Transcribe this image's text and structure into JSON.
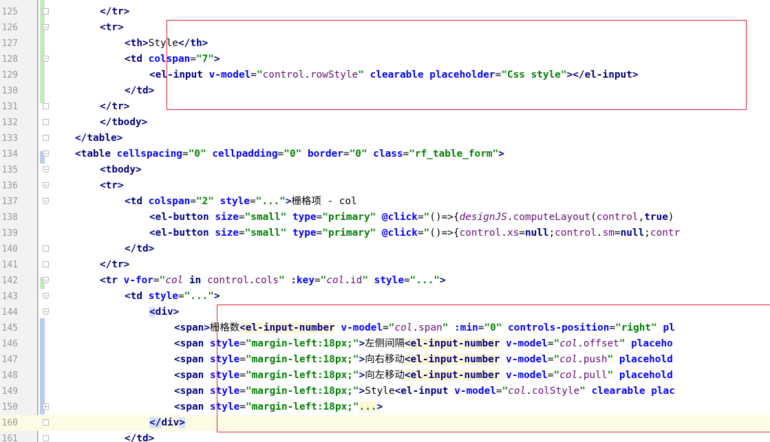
{
  "lines": [
    {
      "num": "125",
      "fold": "+",
      "current": false,
      "segments": [
        [
          "tg",
          "</tr>"
        ]
      ],
      "indent": 8
    },
    {
      "num": "126",
      "fold": "-",
      "current": false,
      "segments": [
        [
          "tg",
          "<tr>"
        ]
      ],
      "indent": 8
    },
    {
      "num": "127",
      "fold": "",
      "current": false,
      "segments": [
        [
          "tg",
          "<th>"
        ],
        [
          "tx",
          "Style"
        ],
        [
          "tg",
          "</th>"
        ]
      ],
      "indent": 12
    },
    {
      "num": "128",
      "fold": "-",
      "current": false,
      "segments": [
        [
          "tg",
          "<td "
        ],
        [
          "an",
          "colspan"
        ],
        [
          "js",
          "="
        ],
        [
          "av",
          "\"7\""
        ],
        [
          "tg",
          ">"
        ]
      ],
      "indent": 12
    },
    {
      "num": "129",
      "fold": "",
      "current": false,
      "segments": [
        [
          "tg",
          "<el-input "
        ],
        [
          "an",
          "v-model"
        ],
        [
          "js",
          "="
        ],
        [
          "av",
          "\""
        ],
        [
          "jsprop",
          "control"
        ],
        [
          "js",
          "."
        ],
        [
          "jsprop",
          "rowStyle"
        ],
        [
          "av",
          "\""
        ],
        [
          "js",
          " "
        ],
        [
          "an",
          "clearable"
        ],
        [
          "js",
          " "
        ],
        [
          "an",
          "placeholder"
        ],
        [
          "js",
          "="
        ],
        [
          "av",
          "\"Css style\""
        ],
        [
          "tg",
          "></el-input>"
        ]
      ],
      "indent": 16
    },
    {
      "num": "130",
      "fold": "",
      "current": false,
      "segments": [
        [
          "tg",
          "</td>"
        ]
      ],
      "indent": 12
    },
    {
      "num": "131",
      "fold": "+",
      "current": false,
      "segments": [
        [
          "tg",
          "</tr>"
        ]
      ],
      "indent": 8
    },
    {
      "num": "132",
      "fold": "+",
      "current": false,
      "segments": [
        [
          "tg",
          "</tbody>"
        ]
      ],
      "indent": 8
    },
    {
      "num": "133",
      "fold": "+",
      "current": false,
      "segments": [
        [
          "tg",
          "</table>"
        ]
      ],
      "indent": 4
    },
    {
      "num": "134",
      "fold": "-",
      "current": false,
      "segments": [
        [
          "tg",
          "<table "
        ],
        [
          "an",
          "cellspacing"
        ],
        [
          "js",
          "="
        ],
        [
          "av",
          "\"0\""
        ],
        [
          "js",
          " "
        ],
        [
          "an",
          "cellpadding"
        ],
        [
          "js",
          "="
        ],
        [
          "av",
          "\"0\""
        ],
        [
          "js",
          " "
        ],
        [
          "an",
          "border"
        ],
        [
          "js",
          "="
        ],
        [
          "av",
          "\"0\""
        ],
        [
          "js",
          " "
        ],
        [
          "an",
          "class"
        ],
        [
          "js",
          "="
        ],
        [
          "av",
          "\"rf_table_form\""
        ],
        [
          "tg",
          ">"
        ]
      ],
      "indent": 4
    },
    {
      "num": "135",
      "fold": "-",
      "current": false,
      "segments": [
        [
          "tg",
          "<tbody>"
        ]
      ],
      "indent": 8
    },
    {
      "num": "136",
      "fold": "-",
      "current": false,
      "segments": [
        [
          "tg",
          "<tr>"
        ]
      ],
      "indent": 8
    },
    {
      "num": "137",
      "fold": "-",
      "current": false,
      "segments": [
        [
          "tg",
          "<td "
        ],
        [
          "an",
          "colspan"
        ],
        [
          "js",
          "="
        ],
        [
          "av",
          "\"2\""
        ],
        [
          "js",
          " "
        ],
        [
          "an",
          "style"
        ],
        [
          "js",
          "="
        ],
        [
          "av",
          "\"...\""
        ],
        [
          "tg",
          ">"
        ],
        [
          "tx",
          "栅格项 - col"
        ]
      ],
      "indent": 12
    },
    {
      "num": "138",
      "fold": "",
      "current": false,
      "segments": [
        [
          "tg",
          "<el-button "
        ],
        [
          "an",
          "size"
        ],
        [
          "js",
          "="
        ],
        [
          "av",
          "\"small\""
        ],
        [
          "js",
          " "
        ],
        [
          "an",
          "type"
        ],
        [
          "js",
          "="
        ],
        [
          "av",
          "\"primary\""
        ],
        [
          "js",
          " "
        ],
        [
          "an",
          "@click"
        ],
        [
          "js",
          "="
        ],
        [
          "av",
          "\""
        ],
        [
          "js",
          "()=>{"
        ],
        [
          "jsid",
          "designJS"
        ],
        [
          "js",
          "."
        ],
        [
          "jsprop",
          "computeLayout"
        ],
        [
          "js",
          "("
        ],
        [
          "jsprop",
          "control"
        ],
        [
          "js",
          ","
        ],
        [
          "kw",
          "true"
        ],
        [
          "js",
          ")"
        ]
      ],
      "indent": 16
    },
    {
      "num": "139",
      "fold": "",
      "current": false,
      "segments": [
        [
          "tg",
          "<el-button "
        ],
        [
          "an",
          "size"
        ],
        [
          "js",
          "="
        ],
        [
          "av",
          "\"small\""
        ],
        [
          "js",
          " "
        ],
        [
          "an",
          "type"
        ],
        [
          "js",
          "="
        ],
        [
          "av",
          "\"primary\""
        ],
        [
          "js",
          " "
        ],
        [
          "an",
          "@click"
        ],
        [
          "js",
          "="
        ],
        [
          "av",
          "\""
        ],
        [
          "js",
          "()=>{"
        ],
        [
          "jsprop",
          "control"
        ],
        [
          "js",
          "."
        ],
        [
          "jsprop",
          "xs"
        ],
        [
          "js",
          "="
        ],
        [
          "kw",
          "null"
        ],
        [
          "js",
          ";"
        ],
        [
          "jsprop",
          "control"
        ],
        [
          "js",
          "."
        ],
        [
          "jsprop",
          "sm"
        ],
        [
          "js",
          "="
        ],
        [
          "kw",
          "null"
        ],
        [
          "js",
          ";"
        ],
        [
          "jsprop",
          "contr"
        ]
      ],
      "indent": 16
    },
    {
      "num": "140",
      "fold": "+",
      "current": false,
      "segments": [
        [
          "tg",
          "</td>"
        ]
      ],
      "indent": 12
    },
    {
      "num": "141",
      "fold": "+",
      "current": false,
      "segments": [
        [
          "tg",
          "</tr>"
        ]
      ],
      "indent": 8
    },
    {
      "num": "142",
      "fold": "-",
      "current": false,
      "segments": [
        [
          "tg",
          "<tr "
        ],
        [
          "an",
          "v-for"
        ],
        [
          "js",
          "="
        ],
        [
          "av",
          "\""
        ],
        [
          "jsid",
          "col"
        ],
        [
          "js",
          " "
        ],
        [
          "kw",
          "in"
        ],
        [
          "js",
          " "
        ],
        [
          "jsprop",
          "control"
        ],
        [
          "js",
          "."
        ],
        [
          "jsprop",
          "cols"
        ],
        [
          "av",
          "\""
        ],
        [
          "js",
          " "
        ],
        [
          "an",
          ":key"
        ],
        [
          "js",
          "="
        ],
        [
          "av",
          "\""
        ],
        [
          "jsid",
          "col"
        ],
        [
          "js",
          "."
        ],
        [
          "jsprop",
          "id"
        ],
        [
          "av",
          "\""
        ],
        [
          "js",
          " "
        ],
        [
          "an",
          "style"
        ],
        [
          "js",
          "="
        ],
        [
          "av",
          "\"...\""
        ],
        [
          "tg",
          ">"
        ]
      ],
      "indent": 8
    },
    {
      "num": "143",
      "fold": "-",
      "current": false,
      "segments": [
        [
          "tg",
          "<td "
        ],
        [
          "an",
          "style"
        ],
        [
          "js",
          "="
        ],
        [
          "av",
          "\"...\""
        ],
        [
          "tg",
          ">"
        ]
      ],
      "indent": 12
    },
    {
      "num": "144",
      "fold": "-",
      "current": false,
      "segments": [
        [
          "tgcur",
          "<"
        ],
        [
          "tg",
          "div"
        ],
        [
          "tg",
          ">"
        ]
      ],
      "indent": 16
    },
    {
      "num": "145",
      "fold": "",
      "current": false,
      "segments": [
        [
          "tg",
          "<span>"
        ],
        [
          "tx",
          "栅格数"
        ],
        [
          "tgel",
          "<el-input-number"
        ],
        [
          "js",
          " "
        ],
        [
          "an",
          "v-model"
        ],
        [
          "js",
          "="
        ],
        [
          "av",
          "\""
        ],
        [
          "jsid",
          "col"
        ],
        [
          "js",
          "."
        ],
        [
          "jsprop",
          "span"
        ],
        [
          "av",
          "\""
        ],
        [
          "js",
          " "
        ],
        [
          "an",
          ":min"
        ],
        [
          "js",
          "="
        ],
        [
          "av",
          "\"0\""
        ],
        [
          "js",
          " "
        ],
        [
          "an",
          "controls-position"
        ],
        [
          "js",
          "="
        ],
        [
          "av",
          "\"right\""
        ],
        [
          "js",
          " "
        ],
        [
          "an",
          "pl"
        ]
      ],
      "indent": 20
    },
    {
      "num": "146",
      "fold": "",
      "current": false,
      "segments": [
        [
          "tg",
          "<span "
        ],
        [
          "an",
          "style"
        ],
        [
          "js",
          "="
        ],
        [
          "av",
          "\"margin-left:18px;\""
        ],
        [
          "tg",
          ">"
        ],
        [
          "tx",
          "左侧间隔"
        ],
        [
          "tgel",
          "<el-input-number"
        ],
        [
          "js",
          " "
        ],
        [
          "an",
          "v-model"
        ],
        [
          "js",
          "="
        ],
        [
          "av",
          "\""
        ],
        [
          "jsid",
          "col"
        ],
        [
          "js",
          "."
        ],
        [
          "jsprop",
          "offset"
        ],
        [
          "av",
          "\""
        ],
        [
          "js",
          " "
        ],
        [
          "an",
          "placeho"
        ]
      ],
      "indent": 20
    },
    {
      "num": "147",
      "fold": "",
      "current": false,
      "segments": [
        [
          "tg",
          "<span "
        ],
        [
          "an",
          "style"
        ],
        [
          "js",
          "="
        ],
        [
          "av",
          "\"margin-left:18px;\""
        ],
        [
          "tg",
          ">"
        ],
        [
          "tx",
          "向右移动"
        ],
        [
          "tgel",
          "<el-input-number"
        ],
        [
          "js",
          " "
        ],
        [
          "an",
          "v-model"
        ],
        [
          "js",
          "="
        ],
        [
          "av",
          "\""
        ],
        [
          "jsid",
          "col"
        ],
        [
          "js",
          "."
        ],
        [
          "jsprop",
          "push"
        ],
        [
          "av",
          "\""
        ],
        [
          "js",
          " "
        ],
        [
          "an",
          "placehold"
        ]
      ],
      "indent": 20
    },
    {
      "num": "148",
      "fold": "",
      "current": false,
      "segments": [
        [
          "tg",
          "<span "
        ],
        [
          "an",
          "style"
        ],
        [
          "js",
          "="
        ],
        [
          "av",
          "\"margin-left:18px;\""
        ],
        [
          "tg",
          ">"
        ],
        [
          "tx",
          "向左移动"
        ],
        [
          "tgel",
          "<el-input-number"
        ],
        [
          "js",
          " "
        ],
        [
          "an",
          "v-model"
        ],
        [
          "js",
          "="
        ],
        [
          "av",
          "\""
        ],
        [
          "jsid",
          "col"
        ],
        [
          "js",
          "."
        ],
        [
          "jsprop",
          "pull"
        ],
        [
          "av",
          "\""
        ],
        [
          "js",
          " "
        ],
        [
          "an",
          "placehold"
        ]
      ],
      "indent": 20
    },
    {
      "num": "149",
      "fold": "",
      "current": false,
      "segments": [
        [
          "tg",
          "<span "
        ],
        [
          "an",
          "style"
        ],
        [
          "js",
          "="
        ],
        [
          "av",
          "\"margin-left:18px;\""
        ],
        [
          "tg",
          ">"
        ],
        [
          "tx",
          "Style"
        ],
        [
          "tg",
          "<el-input "
        ],
        [
          "an",
          "v-model"
        ],
        [
          "js",
          "="
        ],
        [
          "av",
          "\""
        ],
        [
          "jsid",
          "col"
        ],
        [
          "js",
          "."
        ],
        [
          "jsprop",
          "colStyle"
        ],
        [
          "av",
          "\""
        ],
        [
          "js",
          " "
        ],
        [
          "an",
          "clearable"
        ],
        [
          "js",
          " "
        ],
        [
          "an",
          "plac"
        ]
      ],
      "indent": 20
    },
    {
      "num": "150",
      "fold": "box+",
      "current": false,
      "segments": [
        [
          "tg",
          "<span "
        ],
        [
          "an",
          "style"
        ],
        [
          "js",
          "="
        ],
        [
          "av",
          "\"margin-left:18px;\""
        ],
        [
          "ellip",
          "..."
        ],
        [
          "tg",
          ">"
        ]
      ],
      "indent": 20
    },
    {
      "num": "160",
      "fold": "+",
      "current": true,
      "segments": [
        [
          "tgcur",
          "</"
        ],
        [
          "tg",
          "div"
        ],
        [
          "tgcur",
          ">"
        ]
      ],
      "indent": 16
    },
    {
      "num": "161",
      "fold": "+",
      "current": false,
      "segments": [
        [
          "tg",
          "</td>"
        ]
      ],
      "indent": 12
    }
  ]
}
